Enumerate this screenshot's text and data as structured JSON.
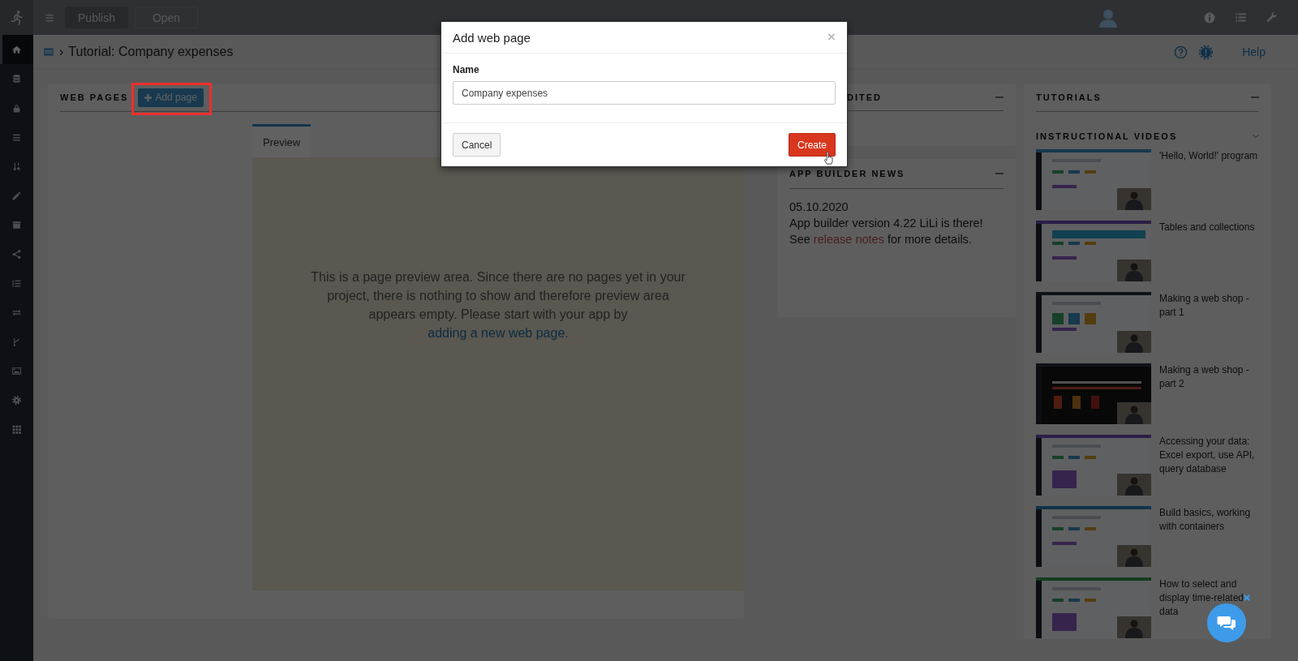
{
  "topbar": {
    "buttons": [
      {
        "label": "Publish",
        "kind": "filled"
      },
      {
        "label": "Open",
        "kind": "outline"
      }
    ]
  },
  "sidebar": {
    "items": [
      {
        "selected": true
      },
      {
        "selected": false
      },
      {
        "selected": false
      },
      {
        "selected": false
      },
      {
        "selected": false
      },
      {
        "selected": false
      },
      {
        "selected": false
      },
      {
        "selected": false
      },
      {
        "selected": false
      },
      {
        "selected": false
      },
      {
        "selected": false
      },
      {
        "selected": false
      },
      {
        "selected": false
      },
      {
        "selected": false
      }
    ]
  },
  "breadcrumb": {
    "separator": "›",
    "title": "Tutorial: Company expenses",
    "help_link": "Help"
  },
  "web_pages": {
    "title": "WEB PAGES",
    "add_button": {
      "label": "Add page",
      "highlighted": true
    },
    "tabs": [
      {
        "label": "Preview",
        "selected": true
      }
    ],
    "preview_message": {
      "text": "This is a page preview area. Since there are no pages yet in your project, there is nothing to show and therefore preview area appears empty. Please start with your app by ",
      "link": "adding a new web page",
      "end": "."
    }
  },
  "recently_edited": {
    "title": "DITED"
  },
  "news": {
    "title": "APP BUILDER NEWS",
    "date": "05.10.2020",
    "text": "App builder version 4.22 LiLi is there!",
    "details": {
      "before": "See ",
      "link": "release notes",
      "after": " for more details."
    }
  },
  "tutorials": {
    "title": "TUTORIALS",
    "section": {
      "title": "INSTRUCTIONAL VIDEOS",
      "expanded": true
    },
    "videos": [
      {
        "title": "'Hello, World!' program",
        "kind": "picture"
      },
      {
        "title": "Tables and collections",
        "kind": "picture"
      },
      {
        "title": "Making a web shop - part 1",
        "kind": "picture"
      },
      {
        "title": "Making a web shop - part 2",
        "kind": "picture"
      },
      {
        "title": "Accessing your data: Excel export, use API, query database",
        "kind": "picture"
      },
      {
        "title": "Build basics, working with containers",
        "kind": "picture"
      },
      {
        "title": "How to select and display time-related data",
        "kind": "picture"
      }
    ]
  },
  "dialog": {
    "title": "Add web page",
    "close": "×",
    "field": {
      "label": "Name",
      "value": "Company expenses"
    },
    "buttons": [
      {
        "label": "Cancel",
        "kind": "default"
      },
      {
        "label": "Create",
        "kind": "primary"
      }
    ]
  }
}
